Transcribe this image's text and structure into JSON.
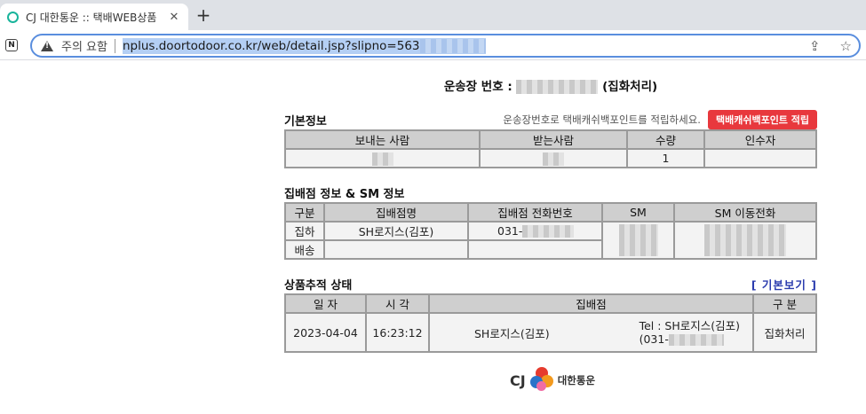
{
  "browser": {
    "tab_title": "CJ 대한통운 :: 택배WEB상품",
    "tab_close": "✕",
    "new_tab": "+",
    "nav_badge": "N",
    "security_label": "주의 요함",
    "url": "nplus.doortodoor.co.kr/web/detail.jsp?slipno=563",
    "share_icon": "⇪",
    "bookmark_icon": "☆"
  },
  "header": {
    "waybill_label": "운송장 번호 :",
    "waybill_status": "(집화처리)"
  },
  "basic_info": {
    "title": "기본정보",
    "point_notice": "운송장번호로 택배캐쉬백포인트를 적립하세요.",
    "point_button": "택배캐쉬백포인트 적립",
    "columns": [
      "보내는 사람",
      "받는사람",
      "수량",
      "인수자"
    ],
    "row": [
      "",
      "",
      "1",
      ""
    ]
  },
  "branch_info": {
    "title": "집배점 정보 & SM 정보",
    "columns": [
      "구분",
      "집배점명",
      "집배점 전화번호",
      "SM",
      "SM 이동전화"
    ],
    "rows": [
      {
        "type": "집하",
        "branch": "SH로지스(김포)",
        "phone": "031-"
      },
      {
        "type": "배송",
        "branch": "",
        "phone": ""
      }
    ]
  },
  "tracking": {
    "title": "상품추적 상태",
    "view_button": "[ 기본보기 ]",
    "columns": [
      "일 자",
      "시 각",
      "집배점",
      "구 분"
    ],
    "rows": [
      {
        "date": "2023-04-04",
        "time": "16:23:12",
        "branch": "SH로지스(김포)",
        "tel": "Tel : SH로지스(김포)",
        "tel2": "(031-",
        "status": "집화처리"
      }
    ]
  },
  "footer": {
    "logo_text": "CJ",
    "brand": "대한통운"
  }
}
